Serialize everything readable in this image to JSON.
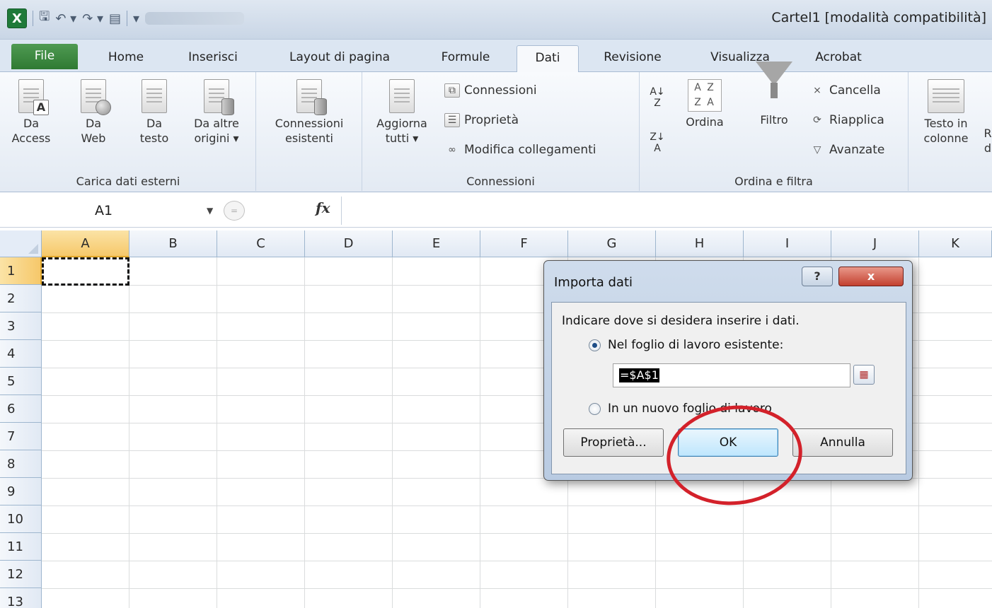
{
  "titlebar": {
    "document_title": "Cartel1  [modalità compatibilità]",
    "qat_icons": [
      "excel-logo",
      "save-icon",
      "undo-icon",
      "redo-icon",
      "form-icon",
      "customize-icon"
    ]
  },
  "tabs": [
    {
      "label": "File",
      "state": "file"
    },
    {
      "label": "Home",
      "state": "normal"
    },
    {
      "label": "Inserisci",
      "state": "normal"
    },
    {
      "label": "Layout di pagina",
      "state": "normal"
    },
    {
      "label": "Formule",
      "state": "normal"
    },
    {
      "label": "Dati",
      "state": "active"
    },
    {
      "label": "Revisione",
      "state": "normal"
    },
    {
      "label": "Visualizza",
      "state": "normal"
    },
    {
      "label": "Acrobat",
      "state": "normal"
    }
  ],
  "ribbon": {
    "external_data": {
      "group_label": "Carica dati esterni",
      "da_access": {
        "line1": "Da",
        "line2": "Access"
      },
      "da_web": {
        "line1": "Da",
        "line2": "Web"
      },
      "da_testo": {
        "line1": "Da",
        "line2": "testo"
      },
      "da_altre": {
        "line1": "Da altre",
        "line2": "origini ▾"
      },
      "conn_esistenti": {
        "line1": "Connessioni",
        "line2": "esistenti"
      }
    },
    "connections": {
      "group_label": "Connessioni",
      "aggiorna": {
        "line1": "Aggiorna",
        "line2": "tutti ▾"
      },
      "connessioni": "Connessioni",
      "proprieta": "Proprietà",
      "modifica": "Modifica collegamenti"
    },
    "sort_filter": {
      "group_label": "Ordina e filtra",
      "ordina": "Ordina",
      "filtro": "Filtro",
      "cancella": "Cancella",
      "riapplica": "Riapplica",
      "avanzate": "Avanzate"
    },
    "data_tools": {
      "testo_colonne": {
        "line1": "Testo in",
        "line2": "colonne"
      },
      "cut_r": "R",
      "cut_d": "d"
    }
  },
  "formula_bar": {
    "name_box": "A1",
    "fx_label": "fx",
    "cancel_symbol": "=",
    "content": ""
  },
  "grid": {
    "columns": [
      "A",
      "B",
      "C",
      "D",
      "E",
      "F",
      "G",
      "H",
      "I",
      "J",
      "K"
    ],
    "rows": [
      "1",
      "2",
      "3",
      "4",
      "5",
      "6",
      "7",
      "8",
      "9",
      "10",
      "11",
      "12",
      "13"
    ],
    "selected_cell": "A1"
  },
  "dialog": {
    "title": "Importa dati",
    "help_label": "?",
    "close_label": "x",
    "prompt": "Indicare dove si desidera inserire i dati.",
    "option_existing": "Nel foglio di lavoro esistente:",
    "option_new": "In un nuovo foglio di lavoro",
    "selected_option": "existing",
    "reference_value": "=$A$1",
    "buttons": {
      "properties": "Proprietà...",
      "ok": "OK",
      "cancel": "Annulla"
    }
  },
  "colors": {
    "selection_header": "#f6c86a",
    "annotation": "#d3212a",
    "file_tab": "#2f7a33"
  }
}
